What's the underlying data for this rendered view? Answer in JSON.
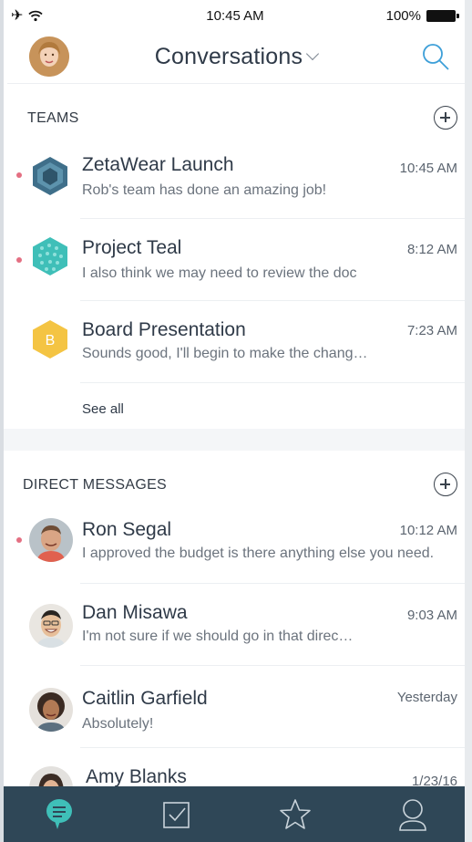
{
  "status_bar": {
    "time": "10:45 AM",
    "battery": "100%"
  },
  "header": {
    "title": "Conversations"
  },
  "teams": {
    "label": "TEAMS",
    "see_all": "See all",
    "items": [
      {
        "name": "ZetaWear Launch",
        "time": "10:45 AM",
        "preview": "Rob's team has done an amazing job!",
        "unread": true,
        "icon_color": "#3f6f8a",
        "icon": "hexagon-team-icon"
      },
      {
        "name": "Project Teal",
        "time": "8:12 AM",
        "preview": "I also think we may need to review the doc",
        "unread": true,
        "icon_color": "#3fbfb8",
        "icon": "hexagon-team-icon"
      },
      {
        "name": "Board Presentation",
        "time": "7:23 AM",
        "preview": "Sounds good, I'll begin to make the chang…",
        "unread": false,
        "icon_color": "#f4c443",
        "icon": "hexagon-team-icon",
        "icon_letter": "B"
      }
    ]
  },
  "direct_messages": {
    "label": "DIRECT MESSAGES",
    "items": [
      {
        "name": "Ron Segal",
        "time": "10:12 AM",
        "preview": "I approved the budget is there anything else you need.",
        "unread": true
      },
      {
        "name": "Dan Misawa",
        "time": "9:03 AM",
        "preview": "I'm not sure if we should go in that direc…",
        "unread": false
      },
      {
        "name": "Caitlin Garfield",
        "time": "Yesterday",
        "preview": "Absolutely!",
        "unread": false
      },
      {
        "name": "Amy Blanks",
        "time": "1/23/16",
        "preview": "",
        "unread": false
      }
    ]
  },
  "tabbar": {
    "tabs": [
      {
        "icon": "chat-bubble-icon",
        "active": true
      },
      {
        "icon": "checkbox-icon",
        "active": false
      },
      {
        "icon": "star-icon",
        "active": false
      },
      {
        "icon": "profile-icon",
        "active": false
      }
    ]
  },
  "colors": {
    "accent": "#3fbfb8",
    "tabbar": "#2f4757",
    "unread": "#e46f82"
  }
}
